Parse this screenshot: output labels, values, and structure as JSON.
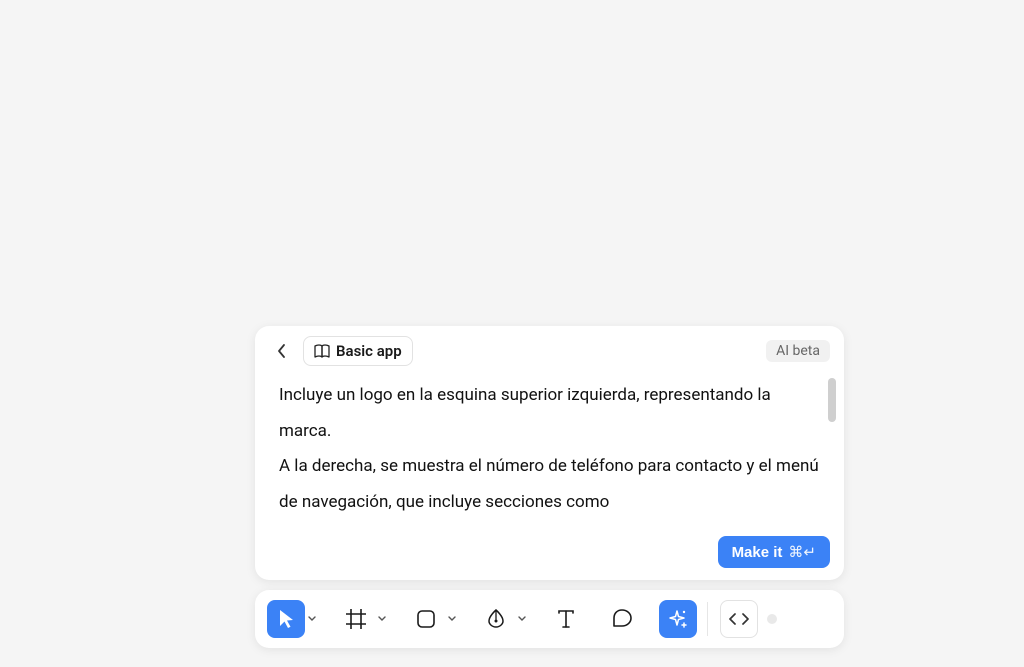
{
  "ai_panel": {
    "chip_label": "Basic app",
    "beta_label": "AI beta",
    "prompt_text": "Incluye un logo en la esquina superior izquierda, representando la marca.\nA la derecha, se muestra el número de teléfono para contacto y el menú de navegación, que incluye secciones como",
    "make_it_label": "Make it",
    "make_it_shortcut": "⌘↵"
  },
  "toolbar": {
    "tools": [
      {
        "name": "select",
        "active": true,
        "has_caret": true
      },
      {
        "name": "frame",
        "active": false,
        "has_caret": true
      },
      {
        "name": "shape",
        "active": false,
        "has_caret": true
      },
      {
        "name": "pen",
        "active": false,
        "has_caret": true
      },
      {
        "name": "text",
        "active": false,
        "has_caret": false
      },
      {
        "name": "comment",
        "active": false,
        "has_caret": false
      },
      {
        "name": "ai-sparkle",
        "active": true,
        "has_caret": false
      }
    ]
  },
  "icons": {
    "select": "cursor-icon",
    "frame": "frame-icon",
    "shape": "square-icon",
    "pen": "pen-icon",
    "text": "text-icon",
    "comment": "chat-icon",
    "ai-sparkle": "sparkle-icon",
    "code": "code-icon",
    "back": "chevron-left-icon",
    "caret": "chevron-down-icon",
    "book": "book-icon"
  }
}
